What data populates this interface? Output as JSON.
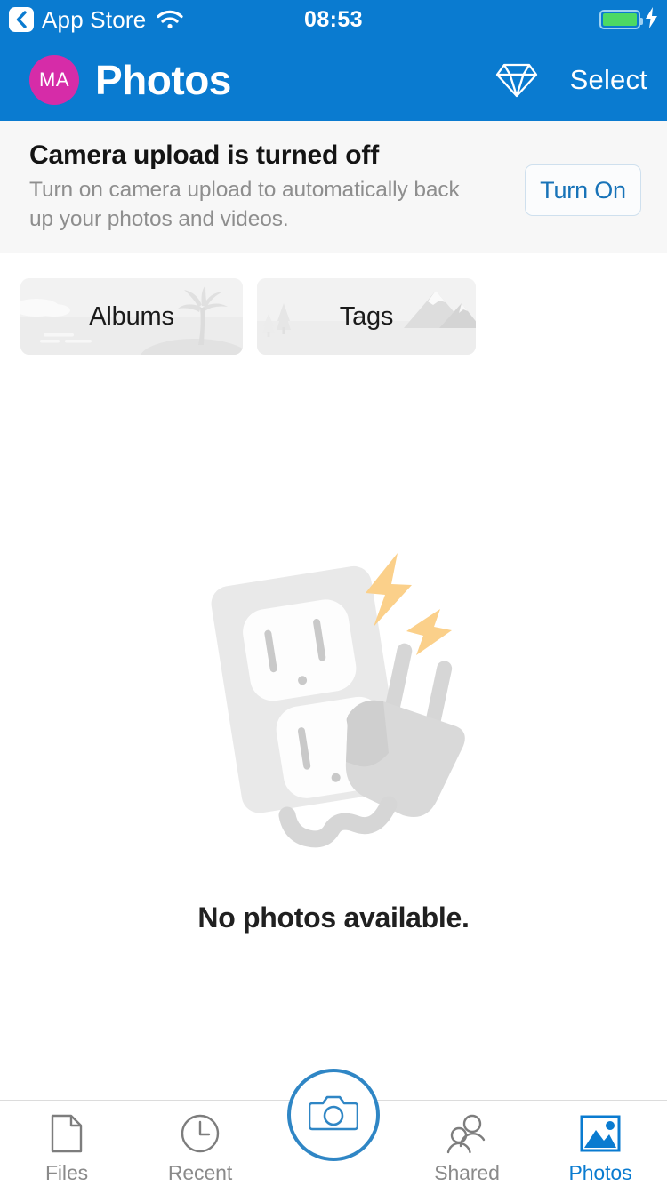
{
  "status_bar": {
    "back_label": "App Store",
    "back_icon": "chevron-left-icon",
    "wifi_icon": "wifi-icon",
    "time": "08:53",
    "battery_icon": "battery-full-icon",
    "charging_icon": "lightning-bolt-icon"
  },
  "nav_bar": {
    "avatar_initials": "MA",
    "title": "Photos",
    "gem_icon": "diamond-icon",
    "select_label": "Select"
  },
  "banner": {
    "title": "Camera upload is turned off",
    "subtitle": "Turn on camera upload to automatically back up your photos and videos.",
    "button_label": "Turn On"
  },
  "cards": [
    {
      "label": "Albums",
      "art": "beach-palm-illustration"
    },
    {
      "label": "Tags",
      "art": "mountain-pines-illustration"
    }
  ],
  "empty_state": {
    "illustration": "unplugged-outlet-illustration",
    "message": "No photos available."
  },
  "tab_bar": {
    "items": [
      {
        "label": "Files",
        "icon": "document-icon",
        "active": false
      },
      {
        "label": "Recent",
        "icon": "clock-icon",
        "active": false
      },
      {
        "label": "",
        "icon": "camera-icon",
        "active": false
      },
      {
        "label": "Shared",
        "icon": "people-icon",
        "active": false
      },
      {
        "label": "Photos",
        "icon": "photo-filled-icon",
        "active": true
      }
    ]
  },
  "colors": {
    "brand_blue": "#0a7bd0",
    "avatar_pink": "#d62ca8",
    "battery_green": "#4cd964",
    "banner_bg": "#f7f7f7",
    "bolt_amber": "#fbd08a",
    "link_blue": "#1873b8"
  }
}
